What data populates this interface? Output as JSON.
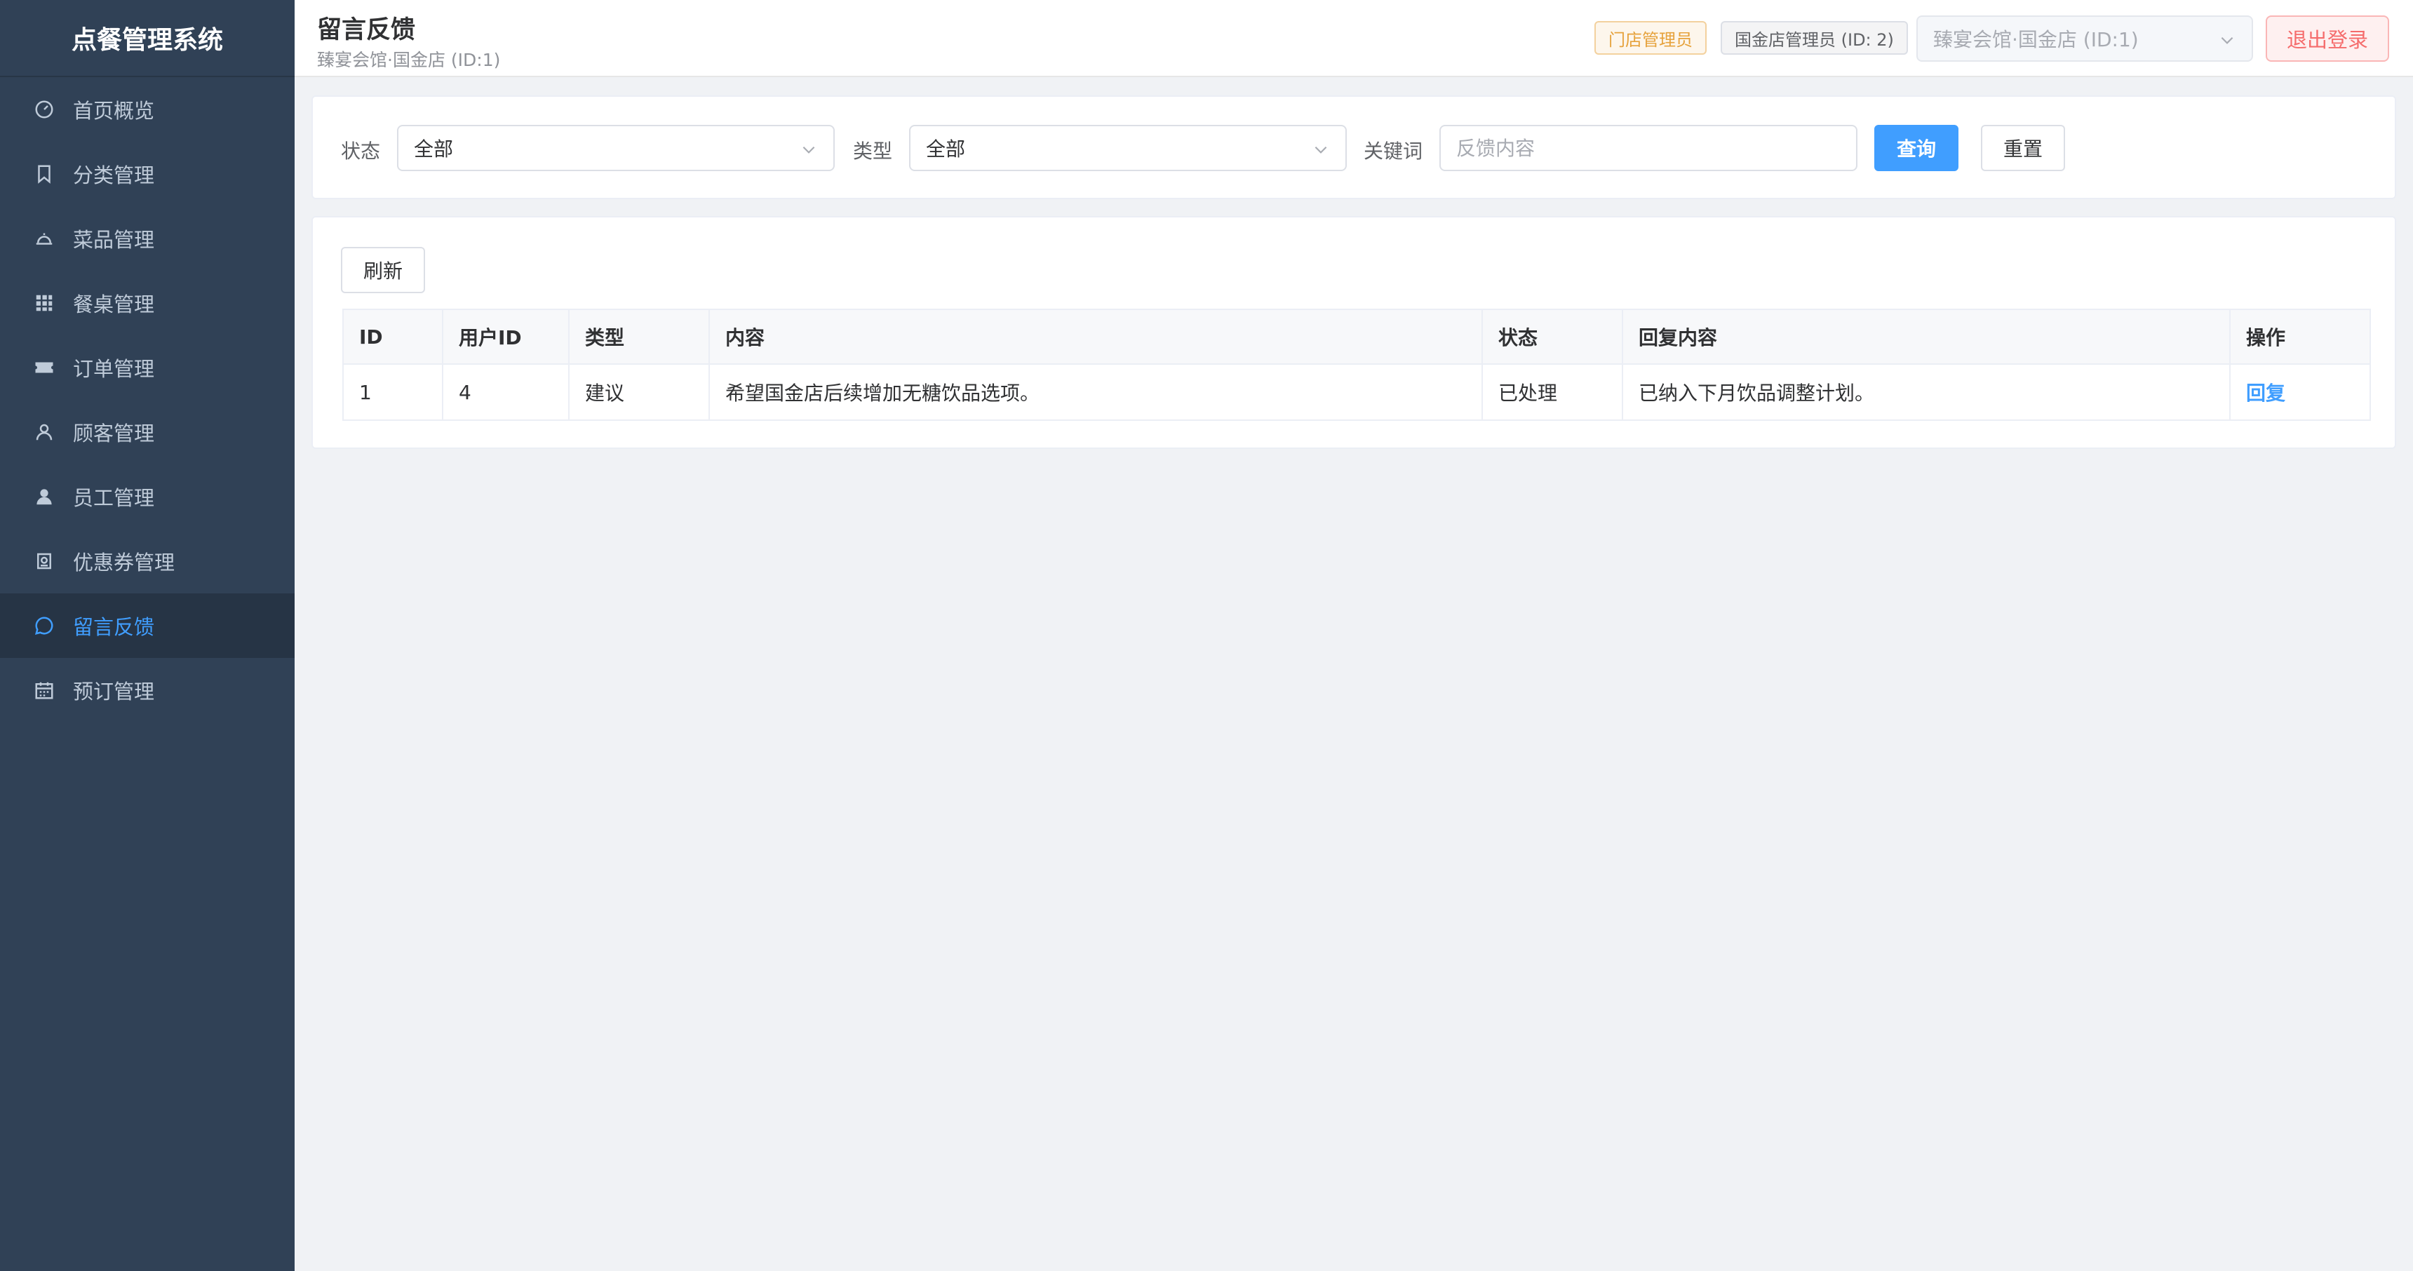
{
  "app": {
    "title": "点餐管理系统"
  },
  "sidebar": {
    "items": [
      {
        "label": "首页概览",
        "icon": "gauge-icon"
      },
      {
        "label": "分类管理",
        "icon": "bookmark-icon"
      },
      {
        "label": "菜品管理",
        "icon": "cloche-icon"
      },
      {
        "label": "餐桌管理",
        "icon": "grid-icon"
      },
      {
        "label": "订单管理",
        "icon": "ticket-icon"
      },
      {
        "label": "顾客管理",
        "icon": "user-outline-icon"
      },
      {
        "label": "员工管理",
        "icon": "user-filled-icon"
      },
      {
        "label": "优惠券管理",
        "icon": "coupon-icon"
      },
      {
        "label": "留言反馈",
        "icon": "chat-icon",
        "active": true
      },
      {
        "label": "预订管理",
        "icon": "calendar-icon"
      }
    ]
  },
  "header": {
    "title": "留言反馈",
    "subtitle": "臻宴会馆·国金店 (ID:1)",
    "role_tag": "门店管理员",
    "user_tag": "国金店管理员 (ID: 2)",
    "store_select": "臻宴会馆·国金店 (ID:1)",
    "logout": "退出登录"
  },
  "filter": {
    "status_label": "状态",
    "status_value": "全部",
    "type_label": "类型",
    "type_value": "全部",
    "keyword_label": "关键词",
    "keyword_placeholder": "反馈内容",
    "keyword_value": "",
    "query_button": "查询",
    "reset_button": "重置"
  },
  "toolbar": {
    "refresh_button": "刷新"
  },
  "table": {
    "headers": [
      "ID",
      "用户ID",
      "类型",
      "内容",
      "状态",
      "回复内容",
      "操作"
    ],
    "rows": [
      {
        "id": "1",
        "user_id": "4",
        "type": "建议",
        "content": "希望国金店后续增加无糖饮品选项。",
        "status": "已处理",
        "reply": "已纳入下月饮品调整计划。",
        "action": "回复"
      }
    ]
  },
  "colors": {
    "sidebar_bg": "#304156",
    "accent": "#409eff",
    "danger": "#f56c6c",
    "warning": "#e6a23c"
  }
}
